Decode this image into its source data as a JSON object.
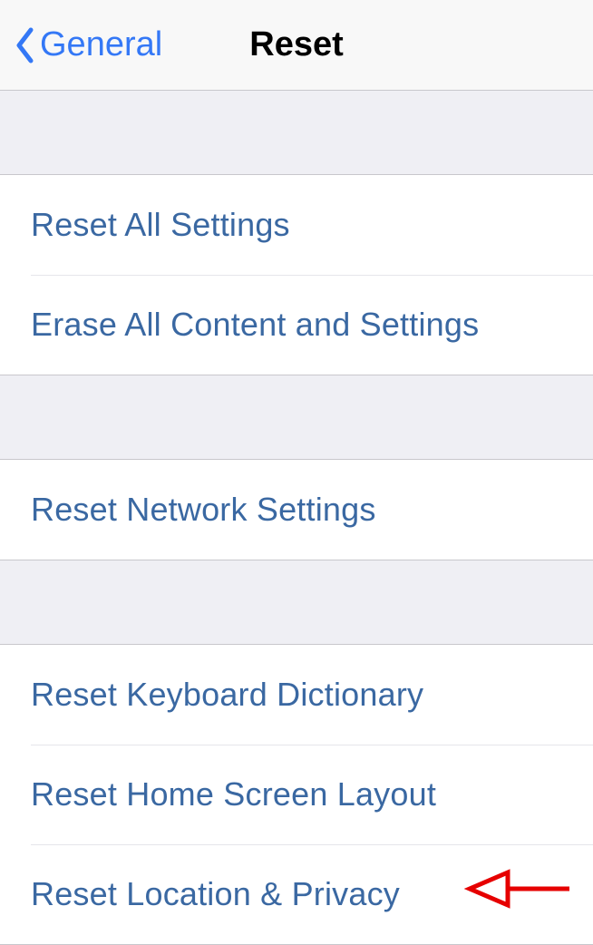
{
  "nav": {
    "back_label": "General",
    "title": "Reset"
  },
  "groups": [
    {
      "rows": [
        {
          "label": "Reset All Settings"
        },
        {
          "label": "Erase All Content and Settings"
        }
      ]
    },
    {
      "rows": [
        {
          "label": "Reset Network Settings"
        }
      ]
    },
    {
      "rows": [
        {
          "label": "Reset Keyboard Dictionary"
        },
        {
          "label": "Reset Home Screen Layout"
        },
        {
          "label": "Reset Location & Privacy"
        }
      ]
    }
  ]
}
